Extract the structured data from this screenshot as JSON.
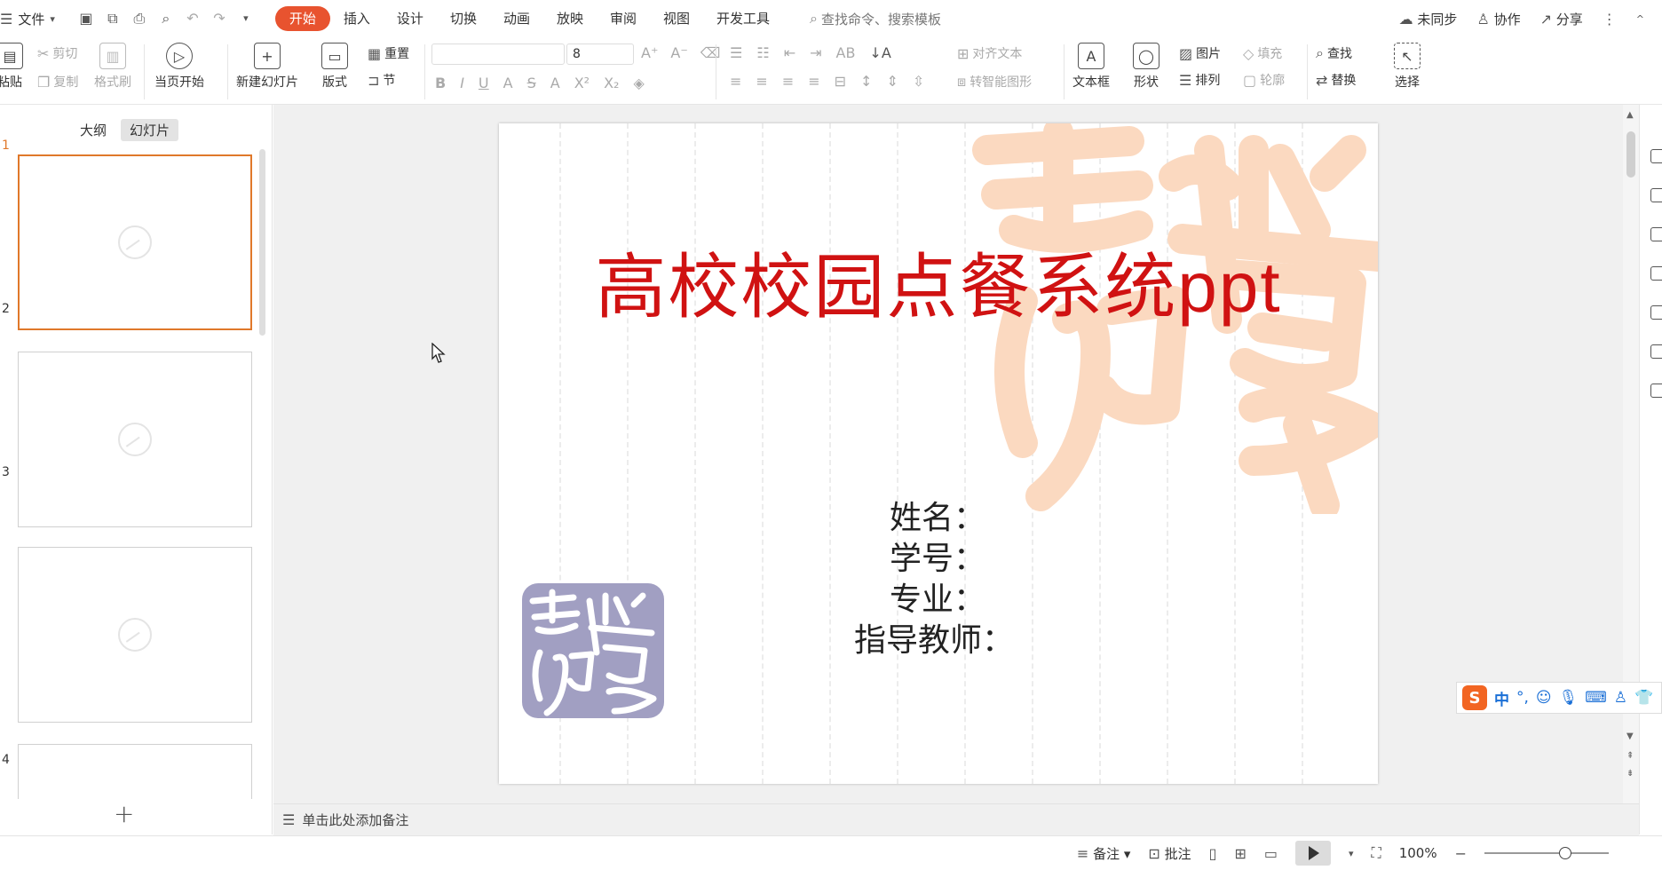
{
  "topbar": {
    "file_label": "文件",
    "tabs": [
      {
        "label": "开始",
        "active": true
      },
      {
        "label": "插入"
      },
      {
        "label": "设计"
      },
      {
        "label": "切换"
      },
      {
        "label": "动画"
      },
      {
        "label": "放映"
      },
      {
        "label": "审阅"
      },
      {
        "label": "视图"
      },
      {
        "label": "开发工具"
      }
    ],
    "search_placeholder": "查找命令、搜索模板",
    "sync_label": "未同步",
    "collab_label": "协作",
    "share_label": "分享"
  },
  "ribbon": {
    "paste": "粘贴",
    "cut": "剪切",
    "copy": "复制",
    "format_painter": "格式刷",
    "from_current": "当页开始",
    "new_slide": "新建幻灯片",
    "layout": "版式",
    "reset": "重置",
    "section": "节",
    "font_size": "8",
    "align_text": "对齐文本",
    "smart_art": "转智能图形",
    "textbox": "文本框",
    "shape": "形状",
    "picture": "图片",
    "arrange": "排列",
    "fill": "填充",
    "outline": "轮廓",
    "find": "查找",
    "replace": "替换",
    "select": "选择"
  },
  "left_panel": {
    "tabs": [
      {
        "label": "大纲"
      },
      {
        "label": "幻灯片",
        "active": true
      }
    ],
    "slide_numbers": [
      "1",
      "2",
      "3",
      "4"
    ],
    "add_label": "+"
  },
  "slide": {
    "title_cjk": "高校校园点餐系统",
    "title_latin": "ppt",
    "info_lines": [
      "姓名：",
      "学号：",
      "专业：",
      "指导教师："
    ],
    "title_color": "#d01212",
    "seal_color_big": "#fbd9c0",
    "seal_color_small": "#a19fc2"
  },
  "notes": {
    "placeholder": "单击此处添加备注"
  },
  "status": {
    "notes_btn": "备注",
    "comments_btn": "批注",
    "zoom": "100%"
  },
  "ime": {
    "mode": "中",
    "punct": "°,"
  }
}
